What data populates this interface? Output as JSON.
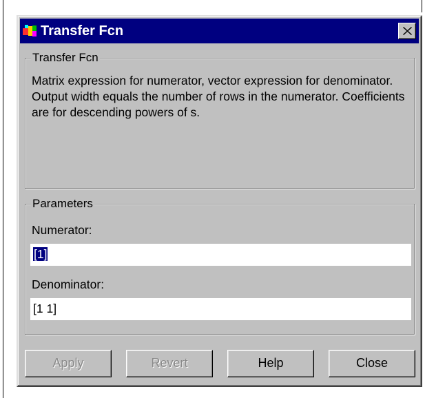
{
  "window": {
    "title": "Transfer Fcn",
    "close_glyph": "✕"
  },
  "description_group": {
    "legend": "Transfer Fcn",
    "text": "Matrix expression for numerator, vector expression for denominator.  Output width equals the number of rows in the numerator.  Coefficients are for descending powers of s."
  },
  "parameters_group": {
    "legend": "Parameters",
    "numerator_label": "Numerator:",
    "numerator_value": "[1]",
    "denominator_label": "Denominator:",
    "denominator_value": "[1 1]"
  },
  "buttons": {
    "apply": "Apply",
    "revert": "Revert",
    "help": "Help",
    "close": "Close"
  },
  "colors": {
    "titlebar": "#000080",
    "dialog_face": "#c0c0c0",
    "selection": "#000080",
    "disabled_text": "#8a8a8a"
  },
  "icons": {
    "app": "simulink-block-icon",
    "close": "close-icon"
  }
}
